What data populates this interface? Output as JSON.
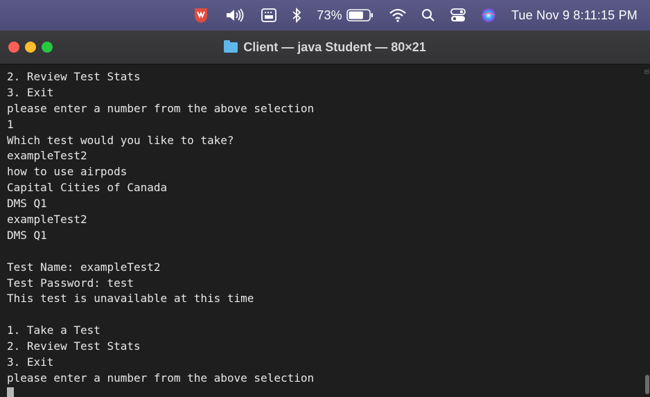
{
  "menubar": {
    "battery_percent": "73%",
    "datetime": "Tue Nov 9  8:11:15 PM",
    "icons": [
      "shield-app-icon",
      "volume-icon",
      "keyboard-input-icon",
      "bluetooth-icon",
      "battery-icon",
      "wifi-icon",
      "spotlight-search-icon",
      "control-center-icon",
      "siri-icon"
    ],
    "battery_level": 0.73
  },
  "window": {
    "title": "Client — java Student — 80×21"
  },
  "terminal": {
    "lines": [
      "2. Review Test Stats",
      "3. Exit",
      "please enter a number from the above selection",
      "1",
      "Which test would you like to take?",
      "exampleTest2",
      "how to use airpods",
      "Capital Cities of Canada",
      "DMS Q1",
      "exampleTest2",
      "DMS Q1",
      "",
      "Test Name: exampleTest2",
      "Test Password: test",
      "This test is unavailable at this time",
      "",
      "1. Take a Test",
      "2. Review Test Stats",
      "3. Exit",
      "please enter a number from the above selection"
    ]
  },
  "colors": {
    "menubar": "#4f4e7a",
    "terminal_bg": "#1e1e1e",
    "terminal_fg": "#e8e8e8",
    "close": "#fe5f57",
    "minimize": "#febc2e",
    "zoom": "#28c840"
  }
}
